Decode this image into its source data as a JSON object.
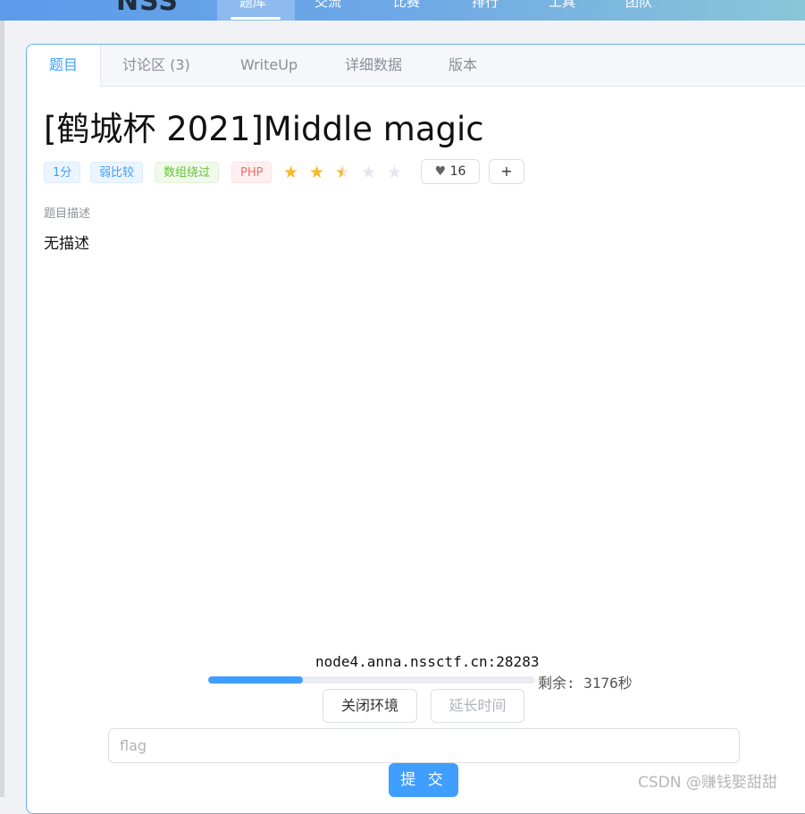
{
  "topnav": {
    "logo": "NSS",
    "items": [
      "题库",
      "交流",
      "比赛",
      "排行",
      "工具",
      "团队"
    ]
  },
  "tabs": [
    {
      "label": "题目"
    },
    {
      "label": "讨论区 (3)"
    },
    {
      "label": "WriteUp"
    },
    {
      "label": "详细数据"
    },
    {
      "label": "版本"
    }
  ],
  "problem": {
    "title": "[鹤城杯 2021]Middle magic",
    "tags": [
      {
        "text": "1分",
        "color": "#409eff"
      },
      {
        "text": "弱比较",
        "color": "#409eff"
      },
      {
        "text": "数组绕过",
        "color": "#67c23a"
      },
      {
        "text": "PHP",
        "color": "#f56c6c"
      }
    ],
    "rating": 2.5,
    "rating_max": 5,
    "likes": "16",
    "add_label": "+",
    "section_label": "题目描述",
    "description": "无描述"
  },
  "environment": {
    "host": "node4.anna.nssctf.cn:28283",
    "progress": 0.29,
    "remaining": "剩余: 3176秒",
    "close_button": "关闭环境",
    "extend_button": "延长时间"
  },
  "submission": {
    "flag_placeholder": "flag",
    "submit_label": "提 交"
  },
  "watermark": "CSDN @赚钱娶甜甜",
  "colors": {
    "primary": "#409eff",
    "star": "#f7ba2a",
    "star_empty": "#e4e7ed"
  }
}
